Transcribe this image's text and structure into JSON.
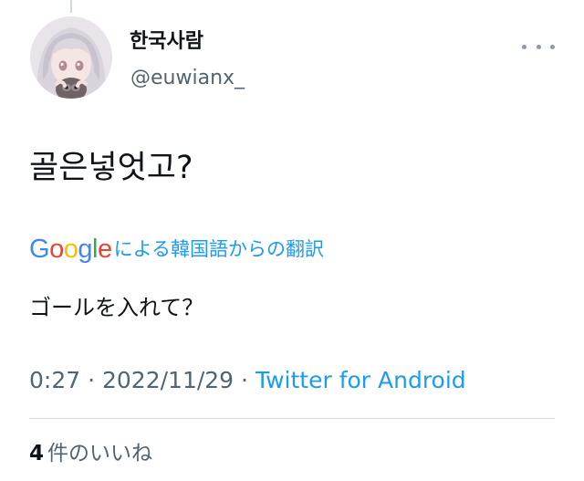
{
  "author": {
    "display_name": "한국사람",
    "handle": "@euwianx_",
    "avatar_icon": "anime-girl-avatar-icon"
  },
  "tweet": {
    "text": "골은넣엇고?"
  },
  "translation": {
    "logo_letters": [
      "G",
      "o",
      "o",
      "g",
      "l",
      "e"
    ],
    "label": "による韓国語からの翻訳",
    "text": "ゴールを入れて？"
  },
  "meta": {
    "time": "0:27",
    "separator": "·",
    "date": "2022/11/29",
    "source": "Twitter for Android"
  },
  "stats": {
    "likes_count": "4",
    "likes_label": "件のいいね"
  },
  "colors": {
    "link": "#1d9bf0",
    "muted": "#536471",
    "text": "#0f1419",
    "divider": "#cfd9de",
    "google_blue": "#4285f4",
    "google_red": "#ea4335",
    "google_yellow": "#fbbc05",
    "google_green": "#34a853"
  }
}
